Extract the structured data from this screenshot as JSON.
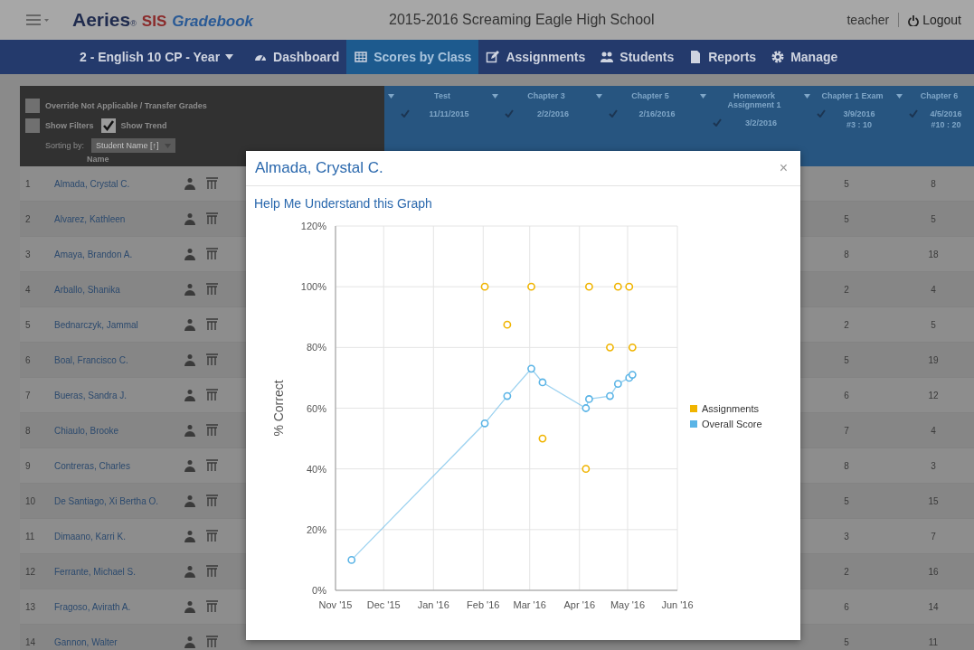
{
  "header": {
    "logo": {
      "brand": "Aeries",
      "registered": "®",
      "product": "SIS",
      "module": "Gradebook"
    },
    "school": "2015-2016 Screaming Eagle High School",
    "user": "teacher",
    "logout": "Logout"
  },
  "nav": {
    "course": "2 - English 10 CP - Year",
    "items": [
      {
        "label": "Dashboard",
        "selected": false
      },
      {
        "label": "Scores by Class",
        "selected": true
      },
      {
        "label": "Assignments",
        "selected": false
      },
      {
        "label": "Students",
        "selected": false
      },
      {
        "label": "Reports",
        "selected": false
      },
      {
        "label": "Manage",
        "selected": false
      }
    ]
  },
  "options": {
    "checkboxes": [
      {
        "label": "Override Not Applicable / Transfer Grades",
        "checked": false
      },
      {
        "label": "Show Filters",
        "checked": false
      },
      {
        "label": "Show Trend",
        "checked": true
      }
    ],
    "sorting_label": "Sorting by:",
    "sorting_value": "Student Name [↑]"
  },
  "table": {
    "name_heading": "Name",
    "assignments": [
      {
        "title": "Test",
        "date": "11/11/2015"
      },
      {
        "title": "Chapter 3",
        "date": "2/2/2016"
      },
      {
        "title": "Chapter 5",
        "date": "2/16/2016"
      },
      {
        "title": "Homework Assignment 1",
        "date": "3/2/2016"
      },
      {
        "title": "Chapter 1 Exam",
        "date": "3/9/2016",
        "points": "#3 : 10"
      },
      {
        "title": "Chapter 6",
        "date": "4/5/2016",
        "points": "#10 : 20"
      }
    ],
    "rows": [
      {
        "number": "1",
        "name": "Almada, Crystal C.",
        "scores": [
          "5",
          "8"
        ]
      },
      {
        "number": "2",
        "name": "Alvarez, Kathleen",
        "scores": [
          "5",
          "5"
        ]
      },
      {
        "number": "3",
        "name": "Amaya, Brandon A.",
        "scores": [
          "8",
          "18"
        ]
      },
      {
        "number": "4",
        "name": "Arballo, Shanika",
        "scores": [
          "2",
          "4"
        ]
      },
      {
        "number": "5",
        "name": "Bednarczyk, Jammal",
        "scores": [
          "2",
          "5"
        ]
      },
      {
        "number": "6",
        "name": "Boal, Francisco C.",
        "scores": [
          "5",
          "19"
        ]
      },
      {
        "number": "7",
        "name": "Bueras, Sandra J.",
        "scores": [
          "6",
          "12"
        ]
      },
      {
        "number": "8",
        "name": "Chiaulo, Brooke",
        "scores": [
          "7",
          "4"
        ]
      },
      {
        "number": "9",
        "name": "Contreras, Charles",
        "scores": [
          "8",
          "3"
        ]
      },
      {
        "number": "10",
        "name": "De Santiago, Xi Bertha O.",
        "scores": [
          "5",
          "15"
        ]
      },
      {
        "number": "11",
        "name": "Dimaano, Karri K.",
        "scores": [
          "3",
          "7"
        ]
      },
      {
        "number": "12",
        "name": "Ferrante, Michael S.",
        "scores": [
          "2",
          "16"
        ]
      },
      {
        "number": "13",
        "name": "Fragoso, Avirath A.",
        "scores": [
          "6",
          "14"
        ]
      },
      {
        "number": "14",
        "name": "Gannon, Walter",
        "scores": [
          "5",
          "11"
        ]
      }
    ]
  },
  "modal": {
    "title": "Almada, Crystal C.",
    "close": "×",
    "help_link": "Help Me Understand this Graph",
    "chart_data": {
      "type": "line",
      "ylabel": "% Correct",
      "x": [
        "2015-11-11",
        "2016-02-02",
        "2016-02-16",
        "2016-03-02",
        "2016-03-09",
        "2016-04-05",
        "2016-04-07",
        "2016-04-20",
        "2016-04-25",
        "2016-05-02",
        "2016-05-04"
      ],
      "grid": true,
      "legend": "right",
      "xlim": [
        "2015-11-01",
        "2016-06-01"
      ],
      "ylim": [
        0,
        120
      ],
      "xticks": [
        {
          "value": "2015-11-01",
          "label": "Nov '15"
        },
        {
          "value": "2015-12-01",
          "label": "Dec '15"
        },
        {
          "value": "2016-01-01",
          "label": "Jan '16"
        },
        {
          "value": "2016-02-01",
          "label": "Feb '16"
        },
        {
          "value": "2016-03-01",
          "label": "Mar '16"
        },
        {
          "value": "2016-04-01",
          "label": "Apr '16"
        },
        {
          "value": "2016-05-01",
          "label": "May '16"
        },
        {
          "value": "2016-06-01",
          "label": "Jun '16"
        }
      ],
      "yticks": [
        {
          "value": 0,
          "label": "0%"
        },
        {
          "value": 20,
          "label": "20%"
        },
        {
          "value": 40,
          "label": "40%"
        },
        {
          "value": 60,
          "label": "60%"
        },
        {
          "value": 80,
          "label": "80%"
        },
        {
          "value": 100,
          "label": "100%"
        },
        {
          "value": 120,
          "label": "120%"
        }
      ],
      "series": [
        {
          "name": "Assignments",
          "color": "#f0b400",
          "type": "scatter",
          "values": [
            null,
            100,
            87.5,
            100,
            50,
            40,
            100,
            80,
            100,
            100,
            80
          ]
        },
        {
          "name": "Overall Score",
          "color": "#5ab4e6",
          "type": "line",
          "marker": true,
          "values": [
            10,
            55,
            64,
            73,
            68.5,
            60,
            63,
            64,
            68,
            70,
            71
          ]
        }
      ]
    }
  }
}
